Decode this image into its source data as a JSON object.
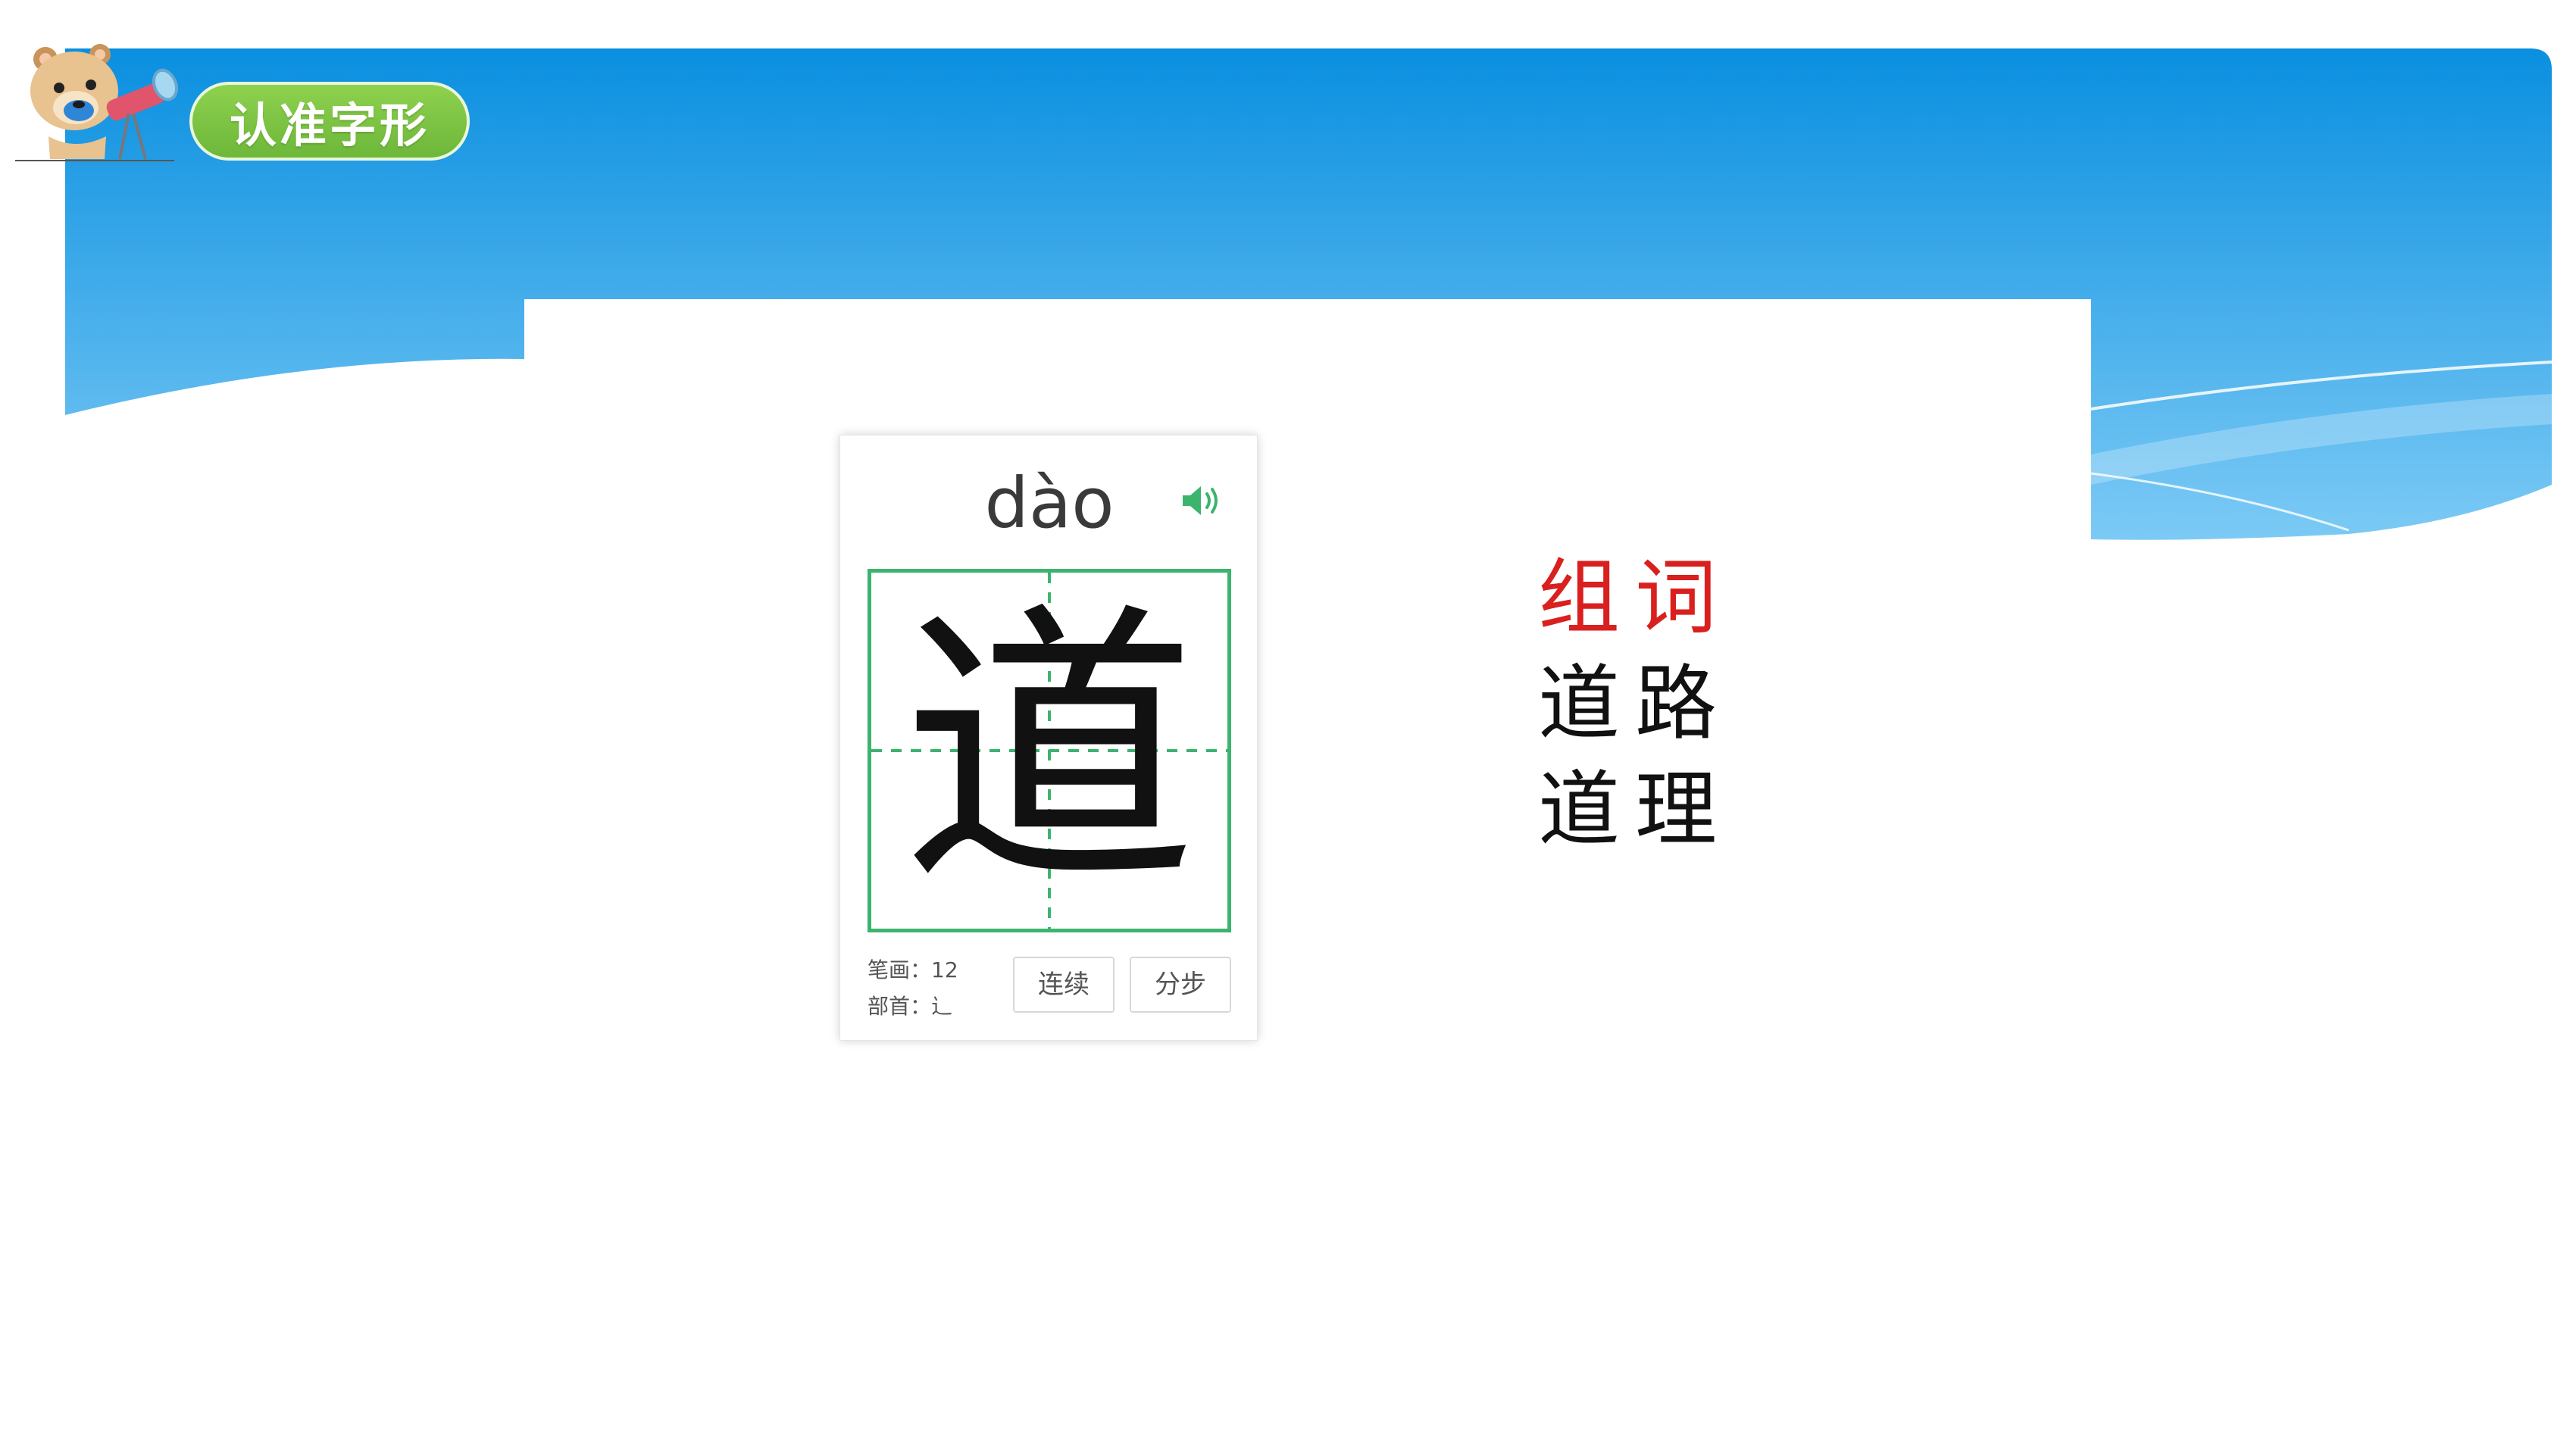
{
  "header": {
    "title": "认准字形"
  },
  "card": {
    "pinyin": "dào",
    "character": "道",
    "strokes_label": "笔画：",
    "strokes_value": "12",
    "radical_label": "部首：",
    "radical_value": "辶",
    "continuous_label": "连续",
    "step_label": "分步"
  },
  "words": {
    "heading": "组词",
    "items": [
      "道路",
      "道理"
    ]
  },
  "colors": {
    "banner_top": "#0a8fe0",
    "banner_bottom": "#6cc4f4",
    "grid_green": "#3cb46e",
    "heading_red": "#d9201f",
    "pill_green": "#7cc444"
  },
  "icons": {
    "speaker": "speaker-icon",
    "mascot": "bear-telescope-icon"
  }
}
